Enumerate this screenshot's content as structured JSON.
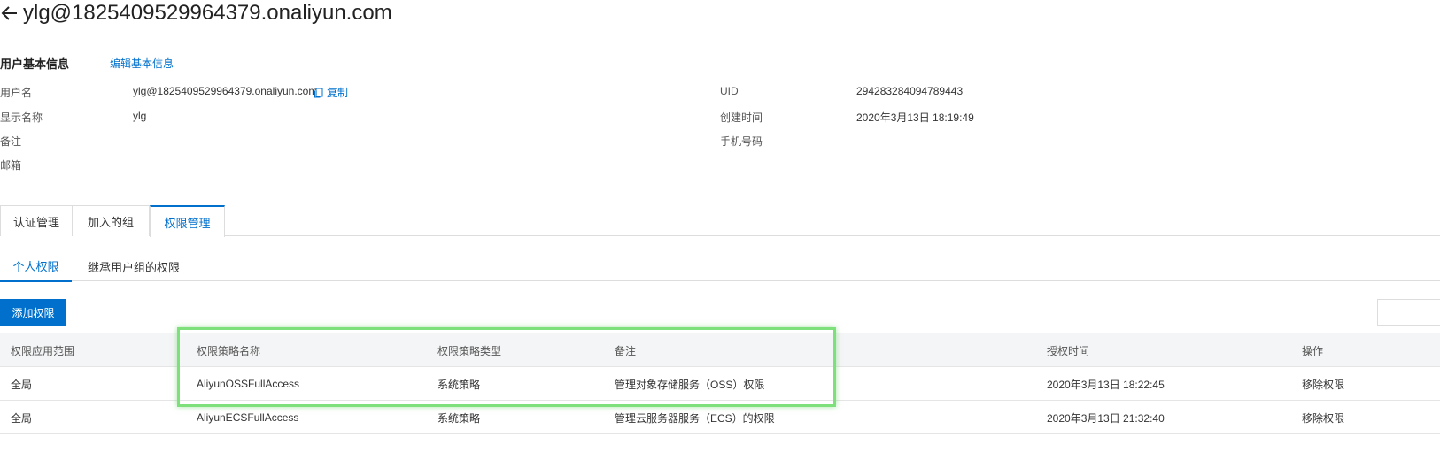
{
  "header": {
    "title": "ylg@1825409529964379.onaliyun.com",
    "back_icon": "arrow-left-icon"
  },
  "basic_info": {
    "section_title": "用户基本信息",
    "edit_link": "编辑基本信息",
    "username_label": "用户名",
    "username_value": "ylg@1825409529964379.onaliyun.com",
    "copy_label": "复制",
    "display_name_label": "显示名称",
    "display_name_value": "ylg",
    "remark_label": "备注",
    "email_label": "邮箱",
    "uid_label": "UID",
    "uid_value": "294283284094789443",
    "created_label": "创建时间",
    "created_value": "2020年3月13日 18:19:49",
    "phone_label": "手机号码"
  },
  "main_tabs": [
    {
      "label": "认证管理",
      "active": false
    },
    {
      "label": "加入的组",
      "active": false
    },
    {
      "label": "权限管理",
      "active": true
    }
  ],
  "sub_tabs": [
    {
      "label": "个人权限",
      "active": true
    },
    {
      "label": "继承用户组的权限",
      "active": false
    }
  ],
  "toolbar": {
    "add_button": "添加权限"
  },
  "table": {
    "headers": [
      "权限应用范围",
      "权限策略名称",
      "权限策略类型",
      "备注",
      "授权时间",
      "操作"
    ],
    "rows": [
      {
        "scope": "全局",
        "policy_name": "AliyunOSSFullAccess",
        "policy_type": "系统策略",
        "remark": "管理对象存储服务（OSS）权限",
        "granted_time": "2020年3月13日 18:22:45",
        "action": "移除权限"
      },
      {
        "scope": "全局",
        "policy_name": "AliyunECSFullAccess",
        "policy_type": "系统策略",
        "remark": "管理云服务器服务（ECS）的权限",
        "granted_time": "2020年3月13日 21:32:40",
        "action": "移除权限"
      }
    ]
  },
  "colors": {
    "accent": "#0070cc",
    "highlight": "#7ee07a",
    "header_bg": "#f4f5f6"
  }
}
